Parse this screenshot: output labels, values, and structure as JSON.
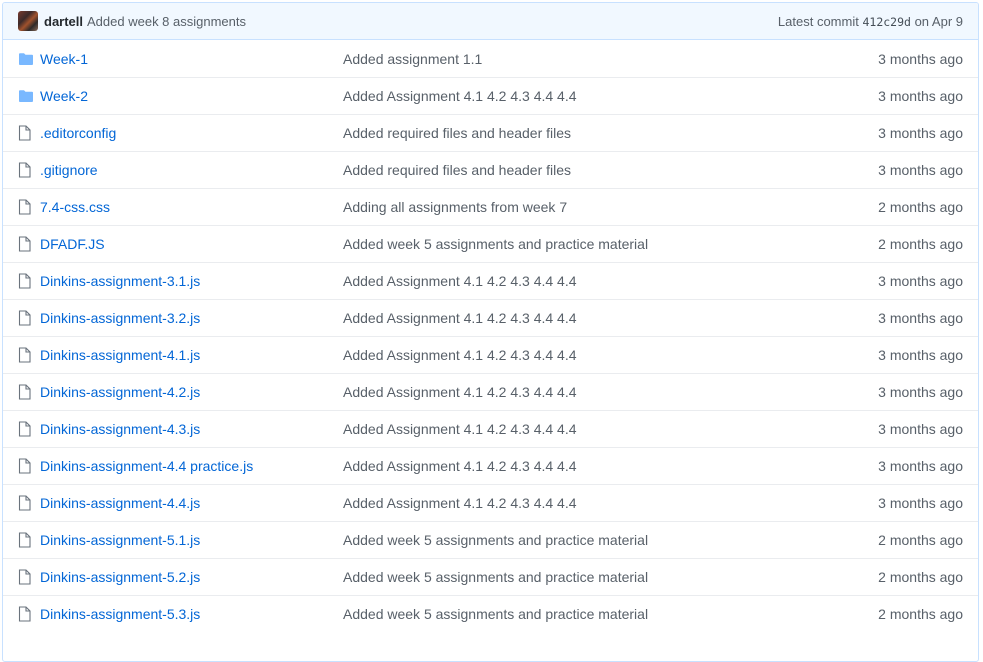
{
  "commit_bar": {
    "author": "dartell",
    "message": "Added week 8 assignments",
    "latest_label": "Latest commit",
    "sha": "412c29d",
    "date": "on Apr 9"
  },
  "colors": {
    "link": "#0366d6",
    "muted": "#586069",
    "folder_icon": "#79b8ff",
    "file_icon": "#6a737d",
    "commit_bar_bg": "#f1f8ff"
  },
  "files": [
    {
      "type": "directory",
      "icon": "folder-icon",
      "name": "Week-1",
      "message": "Added assignment 1.1",
      "age": "3 months ago"
    },
    {
      "type": "directory",
      "icon": "folder-icon",
      "name": "Week-2",
      "message": "Added Assignment 4.1 4.2 4.3 4.4 4.4",
      "age": "3 months ago"
    },
    {
      "type": "file",
      "icon": "file-icon",
      "name": ".editorconfig",
      "message": "Added required files and header files",
      "age": "3 months ago"
    },
    {
      "type": "file",
      "icon": "file-icon",
      "name": ".gitignore",
      "message": "Added required files and header files",
      "age": "3 months ago"
    },
    {
      "type": "file",
      "icon": "file-icon",
      "name": "7.4-css.css",
      "message": "Adding all assignments from week 7",
      "age": "2 months ago"
    },
    {
      "type": "file",
      "icon": "file-icon",
      "name": "DFADF.JS",
      "message": "Added week 5 assignments and practice material",
      "age": "2 months ago"
    },
    {
      "type": "file",
      "icon": "file-icon",
      "name": "Dinkins-assignment-3.1.js",
      "message": "Added Assignment 4.1 4.2 4.3 4.4 4.4",
      "age": "3 months ago"
    },
    {
      "type": "file",
      "icon": "file-icon",
      "name": "Dinkins-assignment-3.2.js",
      "message": "Added Assignment 4.1 4.2 4.3 4.4 4.4",
      "age": "3 months ago"
    },
    {
      "type": "file",
      "icon": "file-icon",
      "name": "Dinkins-assignment-4.1.js",
      "message": "Added Assignment 4.1 4.2 4.3 4.4 4.4",
      "age": "3 months ago"
    },
    {
      "type": "file",
      "icon": "file-icon",
      "name": "Dinkins-assignment-4.2.js",
      "message": "Added Assignment 4.1 4.2 4.3 4.4 4.4",
      "age": "3 months ago"
    },
    {
      "type": "file",
      "icon": "file-icon",
      "name": "Dinkins-assignment-4.3.js",
      "message": "Added Assignment 4.1 4.2 4.3 4.4 4.4",
      "age": "3 months ago"
    },
    {
      "type": "file",
      "icon": "file-icon",
      "name": "Dinkins-assignment-4.4 practice.js",
      "message": "Added Assignment 4.1 4.2 4.3 4.4 4.4",
      "age": "3 months ago"
    },
    {
      "type": "file",
      "icon": "file-icon",
      "name": "Dinkins-assignment-4.4.js",
      "message": "Added Assignment 4.1 4.2 4.3 4.4 4.4",
      "age": "3 months ago"
    },
    {
      "type": "file",
      "icon": "file-icon",
      "name": "Dinkins-assignment-5.1.js",
      "message": "Added week 5 assignments and practice material",
      "age": "2 months ago"
    },
    {
      "type": "file",
      "icon": "file-icon",
      "name": "Dinkins-assignment-5.2.js",
      "message": "Added week 5 assignments and practice material",
      "age": "2 months ago"
    },
    {
      "type": "file",
      "icon": "file-icon",
      "name": "Dinkins-assignment-5.3.js",
      "message": "Added week 5 assignments and practice material",
      "age": "2 months ago"
    }
  ]
}
